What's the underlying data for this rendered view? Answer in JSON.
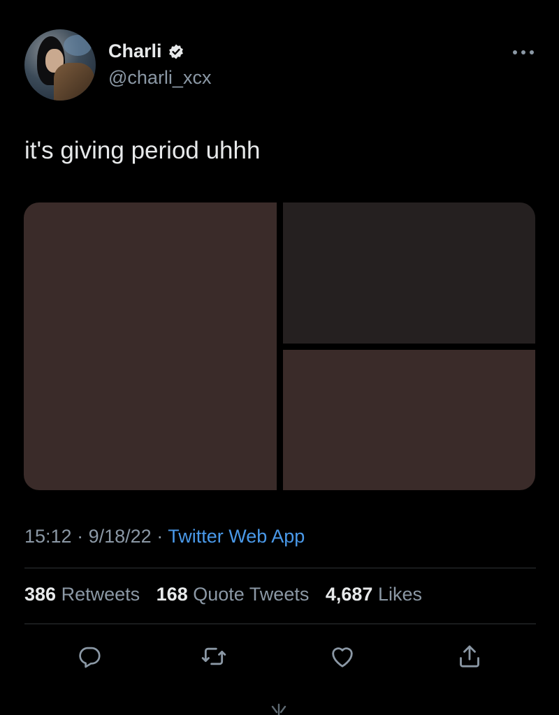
{
  "user": {
    "display_name": "Charli",
    "handle": "@charli_xcx",
    "verified": true
  },
  "tweet": {
    "text": "it's giving period uhhh",
    "media_count": 3,
    "time": "15:12",
    "date": "9/18/22",
    "source": "Twitter Web App"
  },
  "stats": {
    "retweets_count": "386",
    "retweets_label": "Retweets",
    "quotes_count": "168",
    "quotes_label": "Quote Tweets",
    "likes_count": "4,687",
    "likes_label": "Likes"
  },
  "icons": {
    "more": "more-horizontal-icon",
    "verified": "verified-badge-icon",
    "reply": "reply-icon",
    "retweet": "retweet-icon",
    "like": "heart-icon",
    "share": "share-icon"
  },
  "colors": {
    "background": "#000000",
    "link": "#4a99e9",
    "muted": "#8b98a5",
    "text": "#e7e9ea"
  }
}
